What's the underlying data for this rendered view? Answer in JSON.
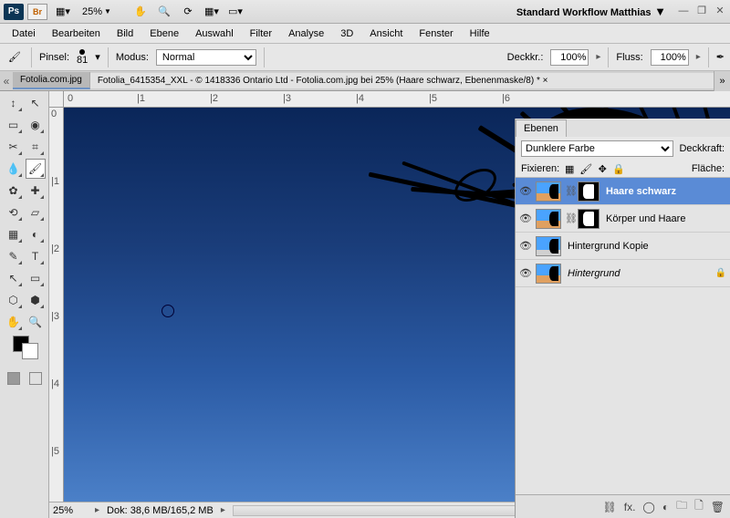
{
  "title": {
    "workspace": "Standard Workflow Matthias",
    "zoom": "25%"
  },
  "menu": [
    "Datei",
    "Bearbeiten",
    "Bild",
    "Ebene",
    "Auswahl",
    "Filter",
    "Analyse",
    "3D",
    "Ansicht",
    "Fenster",
    "Hilfe"
  ],
  "options": {
    "brush_label": "Pinsel:",
    "brush_size": "81",
    "mode_label": "Modus:",
    "mode_value": "Normal",
    "opacity_label": "Deckkr.:",
    "opacity_value": "100%",
    "flow_label": "Fluss:",
    "flow_value": "100%"
  },
  "tabs": {
    "t1": "Fotolia.com.jpg",
    "t2": "Fotolia_6415354_XXL - © 1418336 Ontario Ltd - Fotolia.com.jpg bei 25% (Haare schwarz, Ebenenmaske/8) * ×"
  },
  "ruler": {
    "r0": "0",
    "r1": "|1",
    "r2": "|2",
    "r3": "|3",
    "r4": "|4",
    "r5": "|5",
    "r6": "|6"
  },
  "status": {
    "zoom": "25%",
    "doc": "Dok: 38,6 MB/165,2 MB"
  },
  "panel": {
    "tab": "Ebenen",
    "blend": "Dunklere Farbe",
    "opacity_label": "Deckkraft:",
    "fix_label": "Fixieren:",
    "fill_label": "Fläche:",
    "layers": [
      {
        "name": "Haare schwarz",
        "sel": true,
        "mask": true,
        "bold": true
      },
      {
        "name": "Körper und Haare",
        "sel": false,
        "mask": true,
        "bold": false
      },
      {
        "name": "Hintergrund Kopie",
        "sel": false,
        "mask": false,
        "bold": false
      },
      {
        "name": "Hintergrund",
        "sel": false,
        "mask": false,
        "italic": true,
        "lock": true
      }
    ]
  }
}
